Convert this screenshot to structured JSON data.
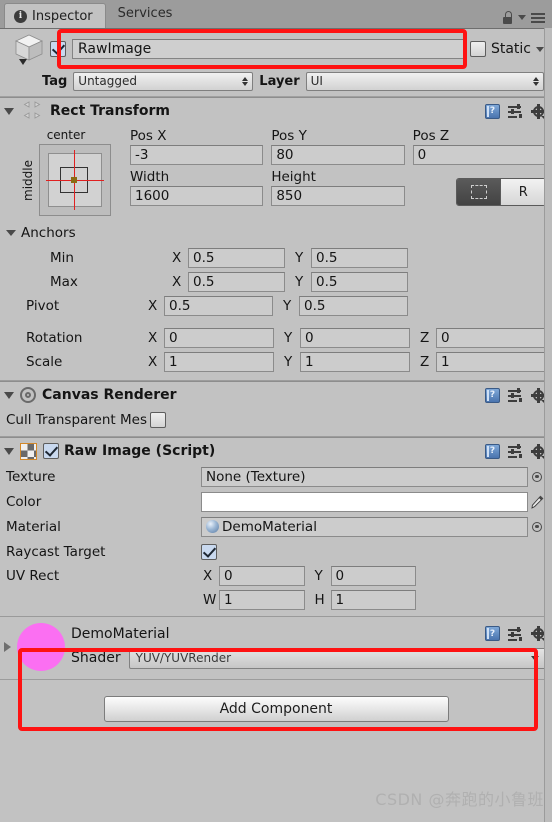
{
  "window": {
    "tabs": [
      {
        "label": "Inspector",
        "icon": "info-icon",
        "active": true
      },
      {
        "label": "Services",
        "icon": "",
        "active": false
      }
    ],
    "lock_icon": "lock-icon",
    "menu_icon": "hamburger-menu-icon"
  },
  "object_header": {
    "icon": "gameobject-cube-icon",
    "enabled_checkbox": true,
    "name": "RawImage",
    "static_checkbox": false,
    "static_label": "Static",
    "tag_label": "Tag",
    "tag_value": "Untagged",
    "layer_label": "Layer",
    "layer_value": "UI"
  },
  "rect_transform": {
    "title": "Rect Transform",
    "anchor_preset": {
      "top_label": "center",
      "left_label": "middle"
    },
    "pos_x": {
      "label": "Pos X",
      "value": "-3"
    },
    "pos_y": {
      "label": "Pos Y",
      "value": "80"
    },
    "pos_z": {
      "label": "Pos Z",
      "value": "0"
    },
    "width": {
      "label": "Width",
      "value": "1600"
    },
    "height": {
      "label": "Height",
      "value": "850"
    },
    "blueprint_toggle": "blueprint-mode-icon",
    "raw_toggle": "R",
    "anchors_label": "Anchors",
    "rows": [
      {
        "name": "Min",
        "indent": "ind",
        "x_axis": "X",
        "x": "0.5",
        "y_axis": "Y",
        "y": "0.5",
        "z_axis": "",
        "z": null
      },
      {
        "name": "Max",
        "indent": "ind",
        "x_axis": "X",
        "x": "0.5",
        "y_axis": "Y",
        "y": "0.5",
        "z_axis": "",
        "z": null
      },
      {
        "name": "Pivot",
        "indent": "ind2",
        "x_axis": "X",
        "x": "0.5",
        "y_axis": "Y",
        "y": "0.5",
        "z_axis": "",
        "z": null
      },
      {
        "name": "Rotation",
        "indent": "ind2",
        "x_axis": "X",
        "x": "0",
        "y_axis": "Y",
        "y": "0",
        "z_axis": "Z",
        "z": "0"
      },
      {
        "name": "Scale",
        "indent": "ind2",
        "x_axis": "X",
        "x": "1",
        "y_axis": "Y",
        "y": "1",
        "z_axis": "Z",
        "z": "1"
      }
    ]
  },
  "canvas_renderer": {
    "title": "Canvas Renderer",
    "icon": "canvas-renderer-target-icon",
    "cull_label": "Cull Transparent Mes",
    "cull_checked": false
  },
  "raw_image": {
    "title": "Raw Image (Script)",
    "icon": "raw-image-checker-icon",
    "enabled": true,
    "texture_label": "Texture",
    "texture_value": "None (Texture)",
    "color_label": "Color",
    "color_value": "#ffffff",
    "material_label": "Material",
    "material_value": "DemoMaterial",
    "raycast_label": "Raycast Target",
    "raycast_checked": true,
    "uv_rect_label": "UV Rect",
    "uv_x_axis": "X",
    "uv_x": "0",
    "uv_y_axis": "Y",
    "uv_y": "0",
    "uv_w_axis": "W",
    "uv_w": "1",
    "uv_h_axis": "H",
    "uv_h": "1"
  },
  "material_inline": {
    "name": "DemoMaterial",
    "preview_color": "#fb6ff2",
    "shader_label": "Shader",
    "shader_value": "YUV/YUVRender"
  },
  "footer": {
    "add_component_label": "Add Component",
    "watermark": "CSDN @奔跑的小鲁班"
  },
  "annotations": {
    "highlight_color": "#fe1212",
    "boxes": [
      "name-field-highlight",
      "material-block-highlight"
    ]
  }
}
